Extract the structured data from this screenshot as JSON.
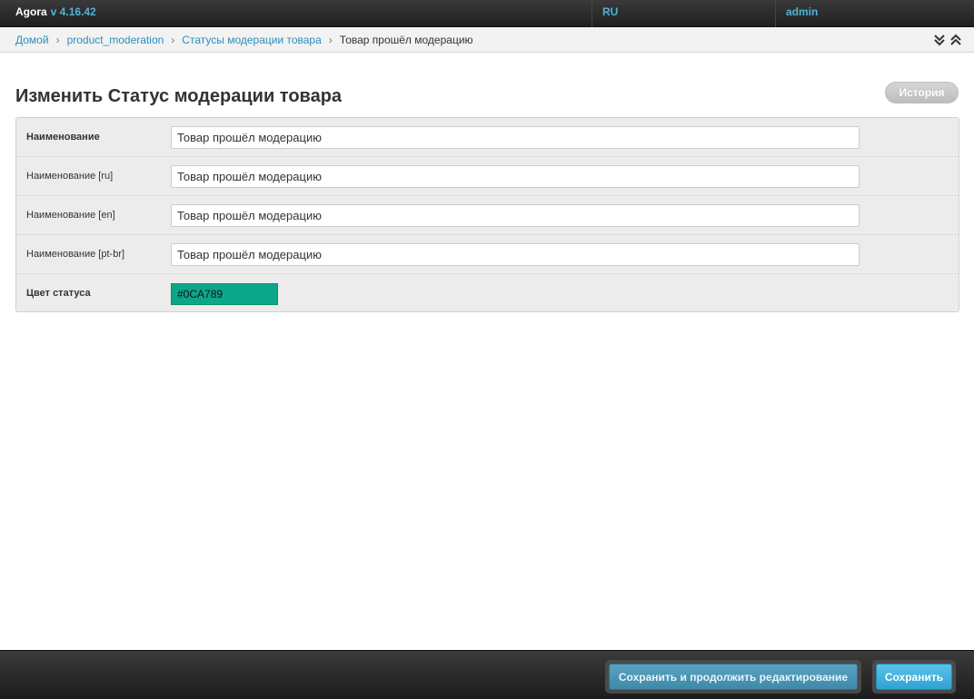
{
  "app": {
    "name": "Agora",
    "version": "v 4.16.42"
  },
  "topbar": {
    "language": "RU",
    "user": "admin"
  },
  "breadcrumbs": {
    "items": [
      "Домой",
      "product_moderation",
      "Статусы модерации товара"
    ],
    "current": "Товар прошёл модерацию"
  },
  "page": {
    "title": "Изменить Статус модерации товара",
    "history_label": "История"
  },
  "form": {
    "fields": [
      {
        "label": "Наименование",
        "value": "Товар прошёл модерацию"
      },
      {
        "label": "Наименование [ru]",
        "value": "Товар прошёл модерацию"
      },
      {
        "label": "Наименование [en]",
        "value": "Товар прошёл модерацию"
      },
      {
        "label": "Наименование [pt-br]",
        "value": "Товар прошёл модерацию"
      }
    ],
    "color": {
      "label": "Цвет статуса",
      "value": "#0CA789"
    }
  },
  "footer": {
    "save_continue_label": "Сохранить и продолжить редактирование",
    "save_label": "Сохранить"
  },
  "colors": {
    "accent": "#2a8fbd",
    "status": "#0CA789"
  }
}
